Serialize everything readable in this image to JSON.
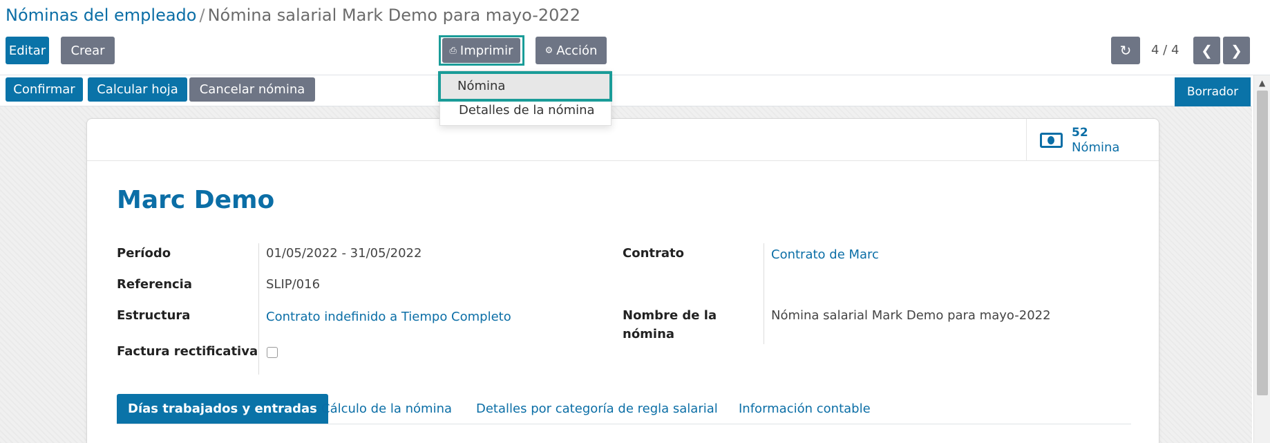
{
  "breadcrumb": {
    "parent": "Nóminas del empleado",
    "separator": "/",
    "current": "Nómina salarial Mark Demo para mayo-2022"
  },
  "toolbar": {
    "edit_label": "Editar",
    "create_label": "Crear",
    "print_label": "Imprimir",
    "action_label": "Acción",
    "pager_text": "4 / 4"
  },
  "print_menu": {
    "items": [
      "Nómina",
      "Detalles de la nómina"
    ]
  },
  "statusbar": {
    "confirm_label": "Confirmar",
    "compute_label": "Calcular hoja",
    "cancel_label": "Cancelar nómina",
    "state_label": "Borrador"
  },
  "smart_button": {
    "value": "52",
    "label": "Nómina"
  },
  "employee": {
    "name": "Marc Demo"
  },
  "fields": {
    "period_label": "Período",
    "period_value": "01/05/2022 - 31/05/2022",
    "reference_label": "Referencia",
    "reference_value": "SLIP/016",
    "structure_label": "Estructura",
    "structure_value": "Contrato indefinido a Tiempo Completo",
    "refund_label": "Factura rectificativa",
    "contract_label": "Contrato",
    "contract_value": "Contrato de Marc",
    "payslip_name_label_line1": "Nombre de la",
    "payslip_name_label_line2": "nómina",
    "payslip_name_value": "Nómina salarial Mark Demo para mayo-2022"
  },
  "tabs": [
    "Días trabajados y entradas",
    "Cálculo de la nómina",
    "Detalles por categoría de regla salarial",
    "Información contable"
  ],
  "colors": {
    "primary": "#0a73a8",
    "secondary": "#6e7585",
    "highlight": "#1a9c98",
    "link": "#0b6ea6"
  }
}
